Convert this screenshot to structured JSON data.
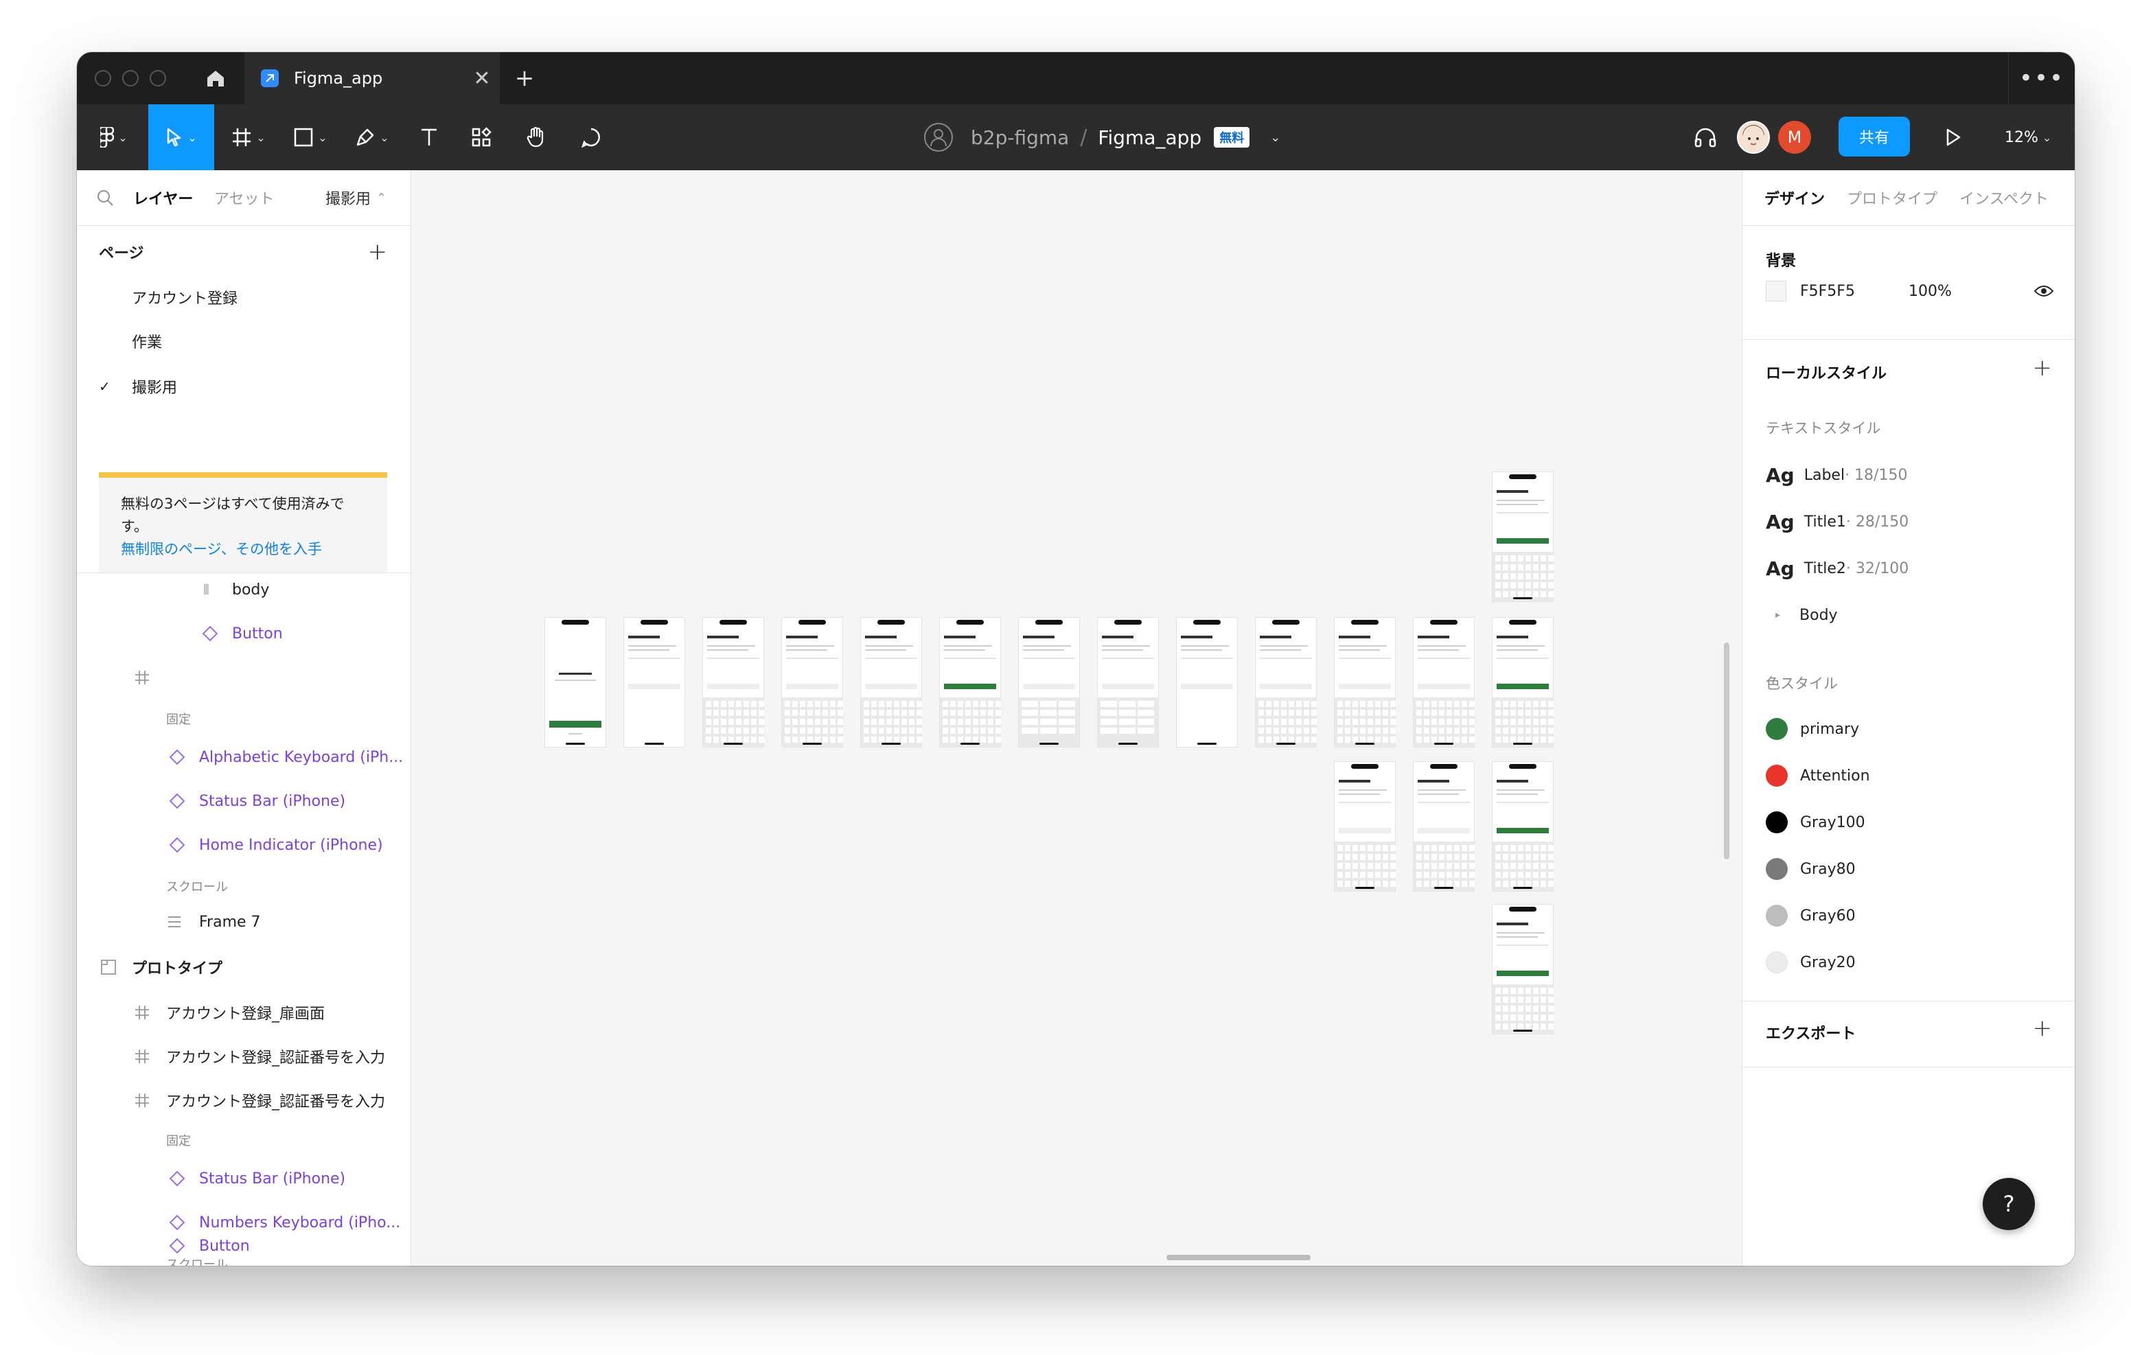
{
  "titlebar": {
    "tab_title": "Figma_app",
    "close": "✕",
    "new_tab": "+",
    "more": "•••"
  },
  "toolbar": {
    "team": "b2p-figma",
    "separator": "/",
    "file": "Figma_app",
    "badge": "無料",
    "share_label": "共有",
    "avatar_letter": "M",
    "zoom": "12%"
  },
  "left_panel": {
    "tabs": [
      "レイヤー",
      "アセット"
    ],
    "page_selector": "撮影用",
    "pages_title": "ページ",
    "pages": [
      "アカウント登録",
      "作業",
      "撮影用"
    ],
    "banner_text": "無料の3ページはすべて使用済みです。",
    "banner_link": "無制限のページ、その他を入手",
    "layers": {
      "body": "body",
      "button1": "Button",
      "fixed1": "固定",
      "alpha_kb": "Alphabetic Keyboard (iPh...",
      "status_bar1": "Status Bar (iPhone)",
      "home_ind": "Home Indicator (iPhone)",
      "scroll1": "スクロール",
      "frame7": "Frame 7",
      "prototype": "プロトタイプ",
      "proto1": "アカウント登録_扉画面",
      "proto2": "アカウント登録_認証番号を入力",
      "proto3": "アカウント登録_認証番号を入力",
      "fixed2": "固定",
      "status_bar2": "Status Bar (iPhone)",
      "num_kb": "Numbers Keyboard (iPho...",
      "scroll2": "スクロール",
      "button2": "Button"
    }
  },
  "right_panel": {
    "tabs": [
      "デザイン",
      "プロトタイプ",
      "インスペクト"
    ],
    "background_title": "背景",
    "bg_hex": "F5F5F5",
    "bg_opacity": "100%",
    "local_styles_title": "ローカルスタイル",
    "text_styles_title": "テキストスタイル",
    "text_styles": [
      {
        "ag": "Ag",
        "name": "Label",
        "meta": " · 18/150"
      },
      {
        "ag": "Ag",
        "name": "Title1",
        "meta": " · 28/150"
      },
      {
        "ag": "Ag",
        "name": "Title2",
        "meta": " · 32/100"
      }
    ],
    "body_group": "Body",
    "color_styles_title": "色スタイル",
    "color_styles": [
      {
        "name": "primary",
        "color": "#2e7d3f"
      },
      {
        "name": "Attention",
        "color": "#e8332a"
      },
      {
        "name": "Gray100",
        "color": "#000000"
      },
      {
        "name": "Gray80",
        "color": "#7a7a7a"
      },
      {
        "name": "Gray60",
        "color": "#bdbdbd"
      },
      {
        "name": "Gray20",
        "color": "#ececec"
      }
    ],
    "export_title": "エクスポート"
  },
  "help": "?"
}
